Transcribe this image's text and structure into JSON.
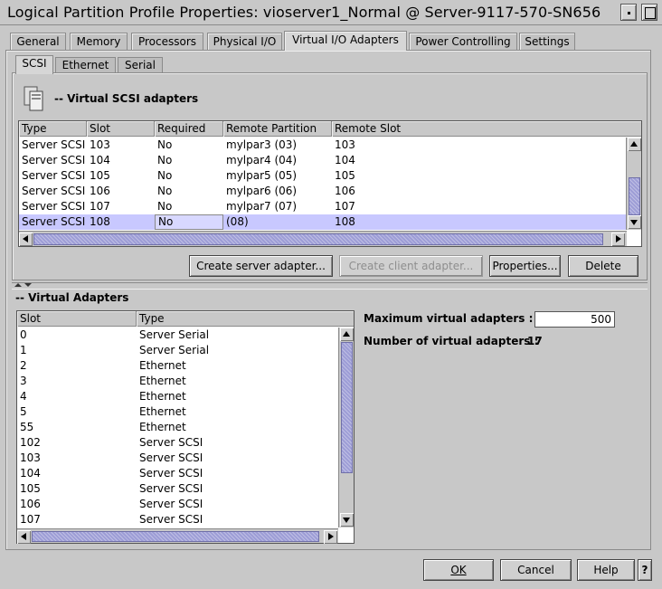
{
  "window": {
    "title": "Logical Partition Profile Properties: vioserver1_Normal @ Server-9117-570-SN656"
  },
  "tabs": [
    {
      "label": "General"
    },
    {
      "label": "Memory"
    },
    {
      "label": "Processors"
    },
    {
      "label": "Physical I/O"
    },
    {
      "label": "Virtual I/O Adapters",
      "active": true
    },
    {
      "label": "Power Controlling"
    },
    {
      "label": "Settings"
    }
  ],
  "subtabs": [
    {
      "label": "SCSI",
      "active": true
    },
    {
      "label": "Ethernet"
    },
    {
      "label": "Serial"
    }
  ],
  "scsi_section": {
    "title": "-- Virtual SCSI adapters",
    "columns": [
      "Type",
      "Slot",
      "Required",
      "Remote Partition",
      "Remote Slot"
    ],
    "rows": [
      [
        "Server SCSI",
        "103",
        "No",
        "mylpar3 (03)",
        "103"
      ],
      [
        "Server SCSI",
        "104",
        "No",
        "mylpar4 (04)",
        "104"
      ],
      [
        "Server SCSI",
        "105",
        "No",
        "mylpar5 (05)",
        "105"
      ],
      [
        "Server SCSI",
        "106",
        "No",
        "mylpar6 (06)",
        "106"
      ],
      [
        "Server SCSI",
        "107",
        "No",
        "mylpar7 (07)",
        "107"
      ],
      [
        "Server SCSI",
        "108",
        "No",
        "(08)",
        "108"
      ]
    ],
    "selected_row_index": 5
  },
  "buttons": {
    "create_server": "Create server adapter...",
    "create_client": "Create client adapter...",
    "properties": "Properties...",
    "delete": "Delete",
    "ok": "OK",
    "cancel": "Cancel",
    "help": "Help",
    "help_q": "?"
  },
  "virtual_adapters": {
    "title": "-- Virtual Adapters",
    "columns": [
      "Slot",
      "Type"
    ],
    "rows": [
      [
        "0",
        "Server Serial"
      ],
      [
        "1",
        "Server Serial"
      ],
      [
        "2",
        "Ethernet"
      ],
      [
        "3",
        "Ethernet"
      ],
      [
        "4",
        "Ethernet"
      ],
      [
        "5",
        "Ethernet"
      ],
      [
        "55",
        "Ethernet"
      ],
      [
        "102",
        "Server SCSI"
      ],
      [
        "103",
        "Server SCSI"
      ],
      [
        "104",
        "Server SCSI"
      ],
      [
        "105",
        "Server SCSI"
      ],
      [
        "106",
        "Server SCSI"
      ],
      [
        "107",
        "Server SCSI"
      ]
    ],
    "max_label": "Maximum virtual adapters :",
    "max_value": "500",
    "count_label": "Number of virtual adapters :",
    "count_value": "17"
  },
  "colors": {
    "background": "#c8c8c8",
    "selection": "#c8c8ff",
    "scroll_thumb": "#9d9dd6"
  }
}
